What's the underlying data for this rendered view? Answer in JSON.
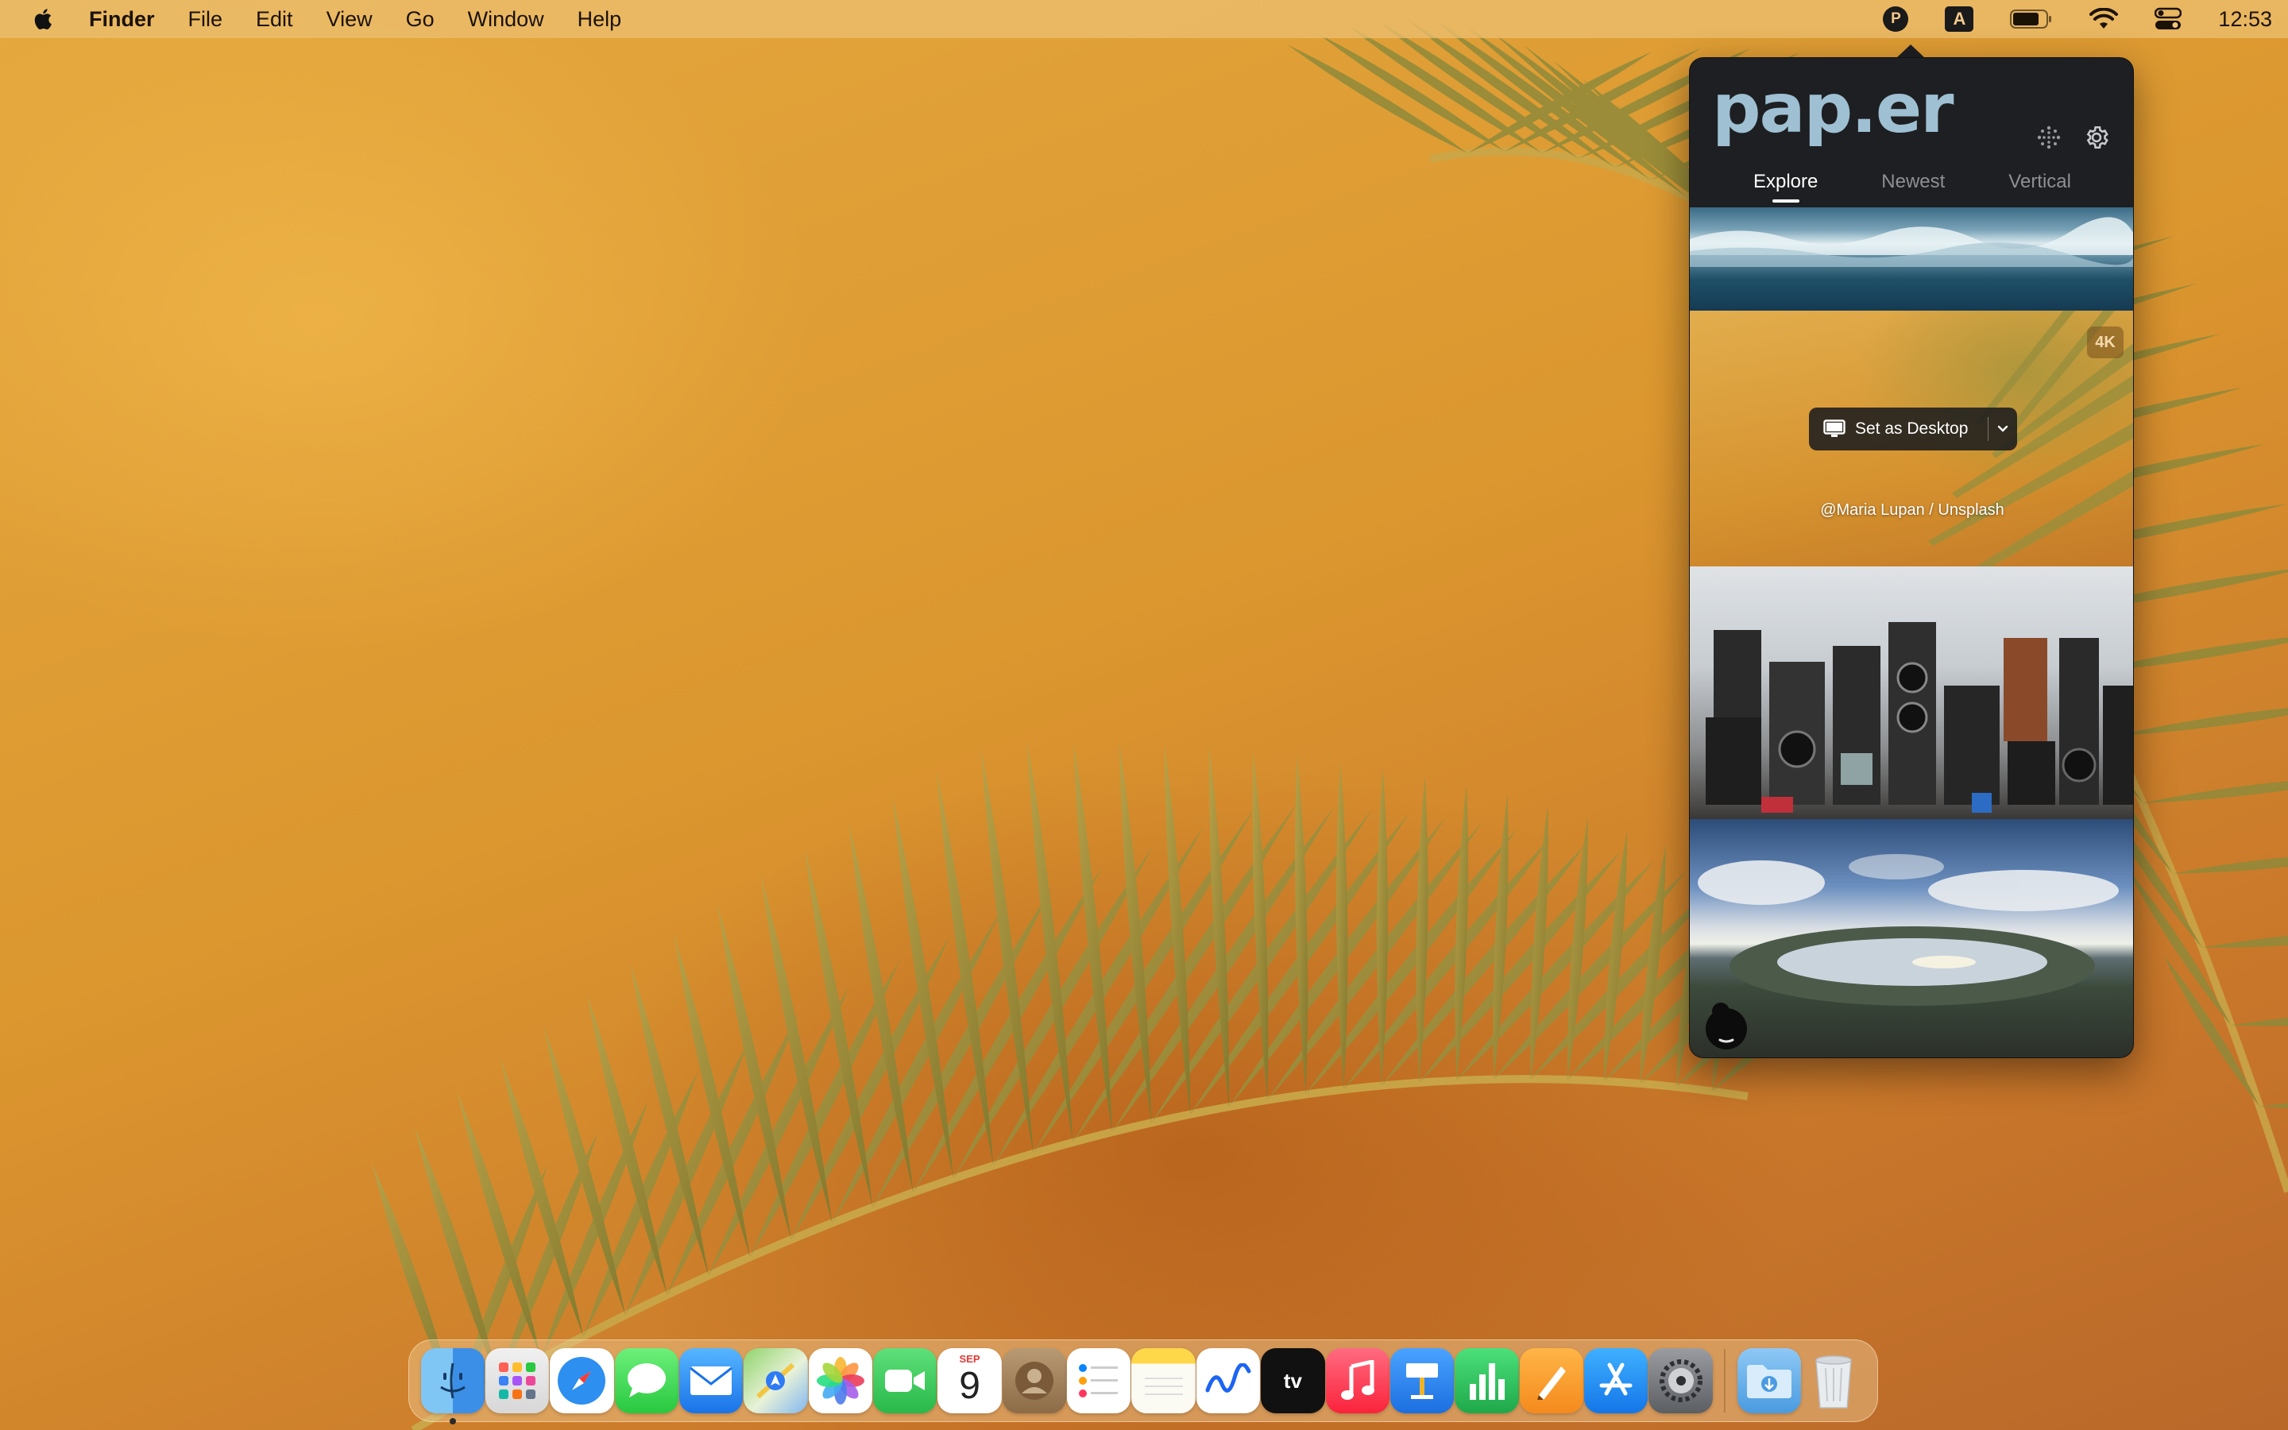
{
  "menubar": {
    "apple_icon": "apple-logo-icon",
    "app_name": "Finder",
    "menus": [
      "File",
      "Edit",
      "View",
      "Go",
      "Window",
      "Help"
    ],
    "status": {
      "paper_letter": "P",
      "input_letter": "A",
      "battery_icon": "battery-icon",
      "wifi_icon": "wifi-icon",
      "control_center_icon": "control-center-icon"
    },
    "clock": "12:53"
  },
  "paper_app": {
    "logo": "pap.er",
    "header_icons": [
      "sparkle-icon",
      "gear-icon"
    ],
    "tabs": [
      {
        "label": "Explore",
        "active": true
      },
      {
        "label": "Newest",
        "active": false
      },
      {
        "label": "Vertical",
        "active": false
      }
    ],
    "thumbnails": [
      {
        "subject": "ocean-waves"
      },
      {
        "subject": "palm-leaves",
        "badge": "4K",
        "action_label": "Set as Desktop",
        "credit": "@Maria Lupan / Unsplash"
      },
      {
        "subject": "vintage-cameras"
      },
      {
        "subject": "landscape-lake"
      }
    ],
    "accent_color": "#9ec0d2",
    "background_color": "#1e1f22"
  },
  "dock": {
    "apps": [
      "Finder",
      "Launchpad",
      "Safari",
      "Messages",
      "Mail",
      "Maps",
      "Photos",
      "FaceTime",
      "Calendar",
      "Contacts",
      "Reminders",
      "Notes",
      "Freeform",
      "TV",
      "Music",
      "Keynote",
      "Numbers",
      "Pages",
      "App Store",
      "System Settings"
    ],
    "calendar": {
      "month": "SEP",
      "day": "9"
    },
    "tv_label": "tv",
    "extras": [
      "Downloads",
      "Trash"
    ]
  }
}
